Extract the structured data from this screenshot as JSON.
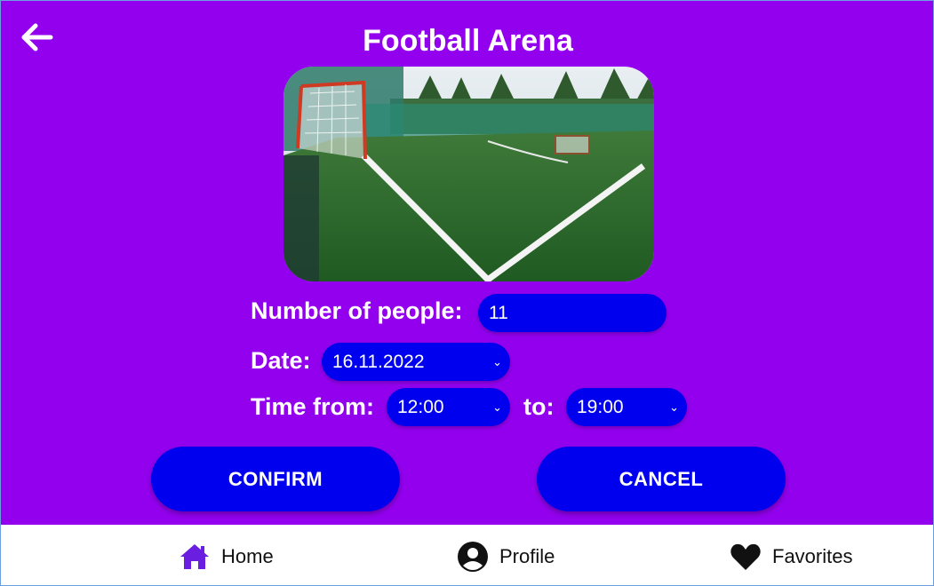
{
  "header": {
    "title": "Football Arena",
    "back_icon": "arrow-left-icon"
  },
  "form": {
    "people_label": "Number of people:",
    "people_value": "11",
    "date_label": "Date:",
    "date_value": "16.11.2022",
    "time_from_label": "Time from:",
    "time_from_value": "12:00",
    "time_to_label": "to:",
    "time_to_value": "19:00"
  },
  "actions": {
    "confirm_label": "CONFIRM",
    "cancel_label": "CANCEL"
  },
  "navbar": {
    "items": [
      {
        "label": "Home",
        "icon": "home-icon"
      },
      {
        "label": "Profile",
        "icon": "profile-icon"
      },
      {
        "label": "Favorites",
        "icon": "heart-icon"
      }
    ]
  },
  "colors": {
    "background": "#9300ee",
    "accent": "#0000ee",
    "home_icon": "#6a1ee0",
    "navbar_background": "#ffffff"
  }
}
